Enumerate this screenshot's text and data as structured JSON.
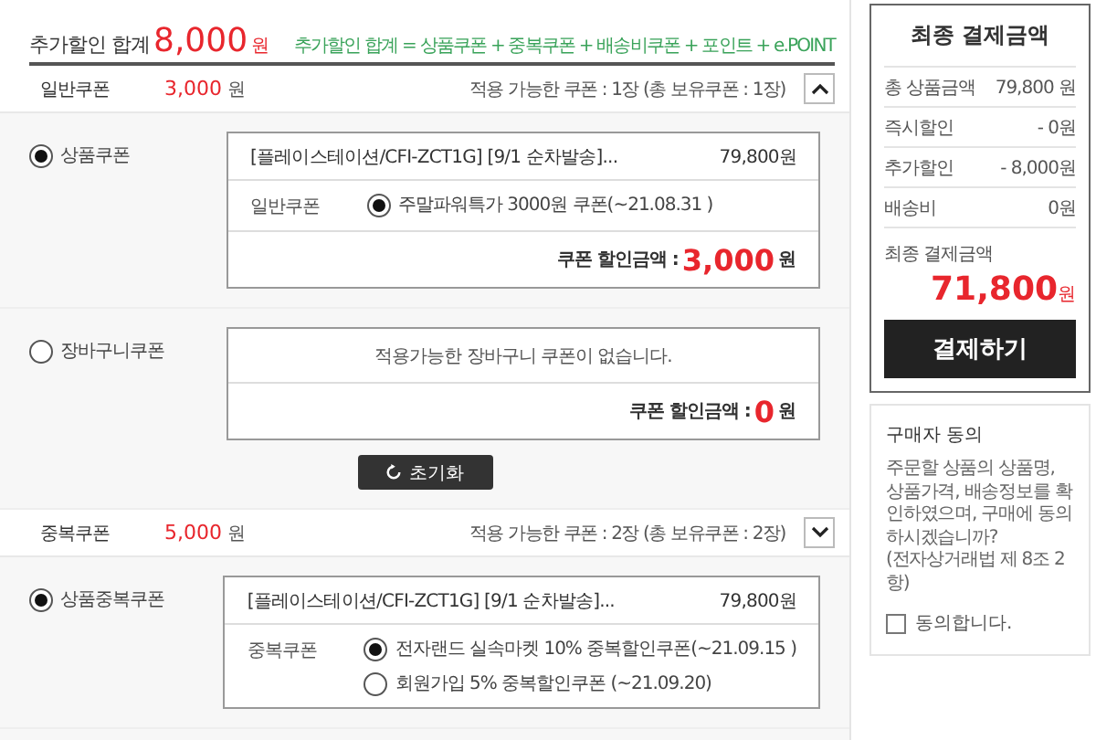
{
  "summary": {
    "label": "추가할인 합계",
    "amount": "8,000",
    "unit": "원",
    "formula": "추가할인 합계 = 상품쿠폰 + 중복쿠폰 + 배송비쿠폰 + 포인트 + e.POINT"
  },
  "coupon_groups": [
    {
      "name": "일반쿠폰",
      "amount": "3,000",
      "unit": "원",
      "availability": "적용 가능한 쿠폰 : 1장 (총 보유쿠폰 : 1장)",
      "expanded": true,
      "reset_button": "초기화",
      "options": [
        {
          "kind": "product",
          "label": "상품쿠폰",
          "selected": true,
          "product": "[플레이스테이션/CFI-ZCT1G] [9/1 순차발송]...",
          "price": "79,800원",
          "coupon_type": "일반쿠폰",
          "coupons": [
            {
              "label": "주말파워특가 3000원 쿠폰(~21.08.31 )",
              "selected": true
            }
          ],
          "discount_label": "쿠폰 할인금액 :",
          "discount": "3,000",
          "discount_unit": "원"
        },
        {
          "kind": "cart",
          "label": "장바구니쿠폰",
          "selected": false,
          "message": "적용가능한 장바구니 쿠폰이 없습니다.",
          "discount_label": "쿠폰 할인금액 :",
          "discount": "0",
          "discount_unit": "원"
        }
      ]
    },
    {
      "name": "중복쿠폰",
      "amount": "5,000",
      "unit": "원",
      "availability": "적용 가능한 쿠폰 : 2장 (총 보유쿠폰 : 2장)",
      "expanded": false,
      "options": [
        {
          "kind": "product",
          "label": "상품중복쿠폰",
          "selected": true,
          "product": "[플레이스테이션/CFI-ZCT1G] [9/1 순차발송]...",
          "price": "79,800원",
          "coupon_type": "중복쿠폰",
          "coupons": [
            {
              "label": "전자랜드 실속마켓 10% 중복할인쿠폰(~21.09.15 )",
              "selected": true
            },
            {
              "label": "회원가입 5% 중복할인쿠폰 (~21.09.20)",
              "selected": false
            }
          ]
        }
      ]
    }
  ],
  "payment": {
    "title": "최종 결제금액",
    "rows": [
      {
        "label": "총 상품금액",
        "value": "79,800 원"
      },
      {
        "label": "즉시할인",
        "value": "- 0원"
      },
      {
        "label": "추가할인",
        "value": "- 8,000원"
      },
      {
        "label": "배송비",
        "value": "0원"
      }
    ],
    "final_label": "최종 결제금액",
    "final_amount": "71,800",
    "final_unit": "원",
    "pay_button": "결제하기"
  },
  "agreement": {
    "title": "구매자 동의",
    "text": "주문할 상품의 상품명, 상품가격, 배송정보를 확인하였으며, 구매에 동의하시겠습니까?",
    "note": "(전자상거래법 제 8조 2항)",
    "checkbox_label": "동의합니다.",
    "checked": false
  }
}
